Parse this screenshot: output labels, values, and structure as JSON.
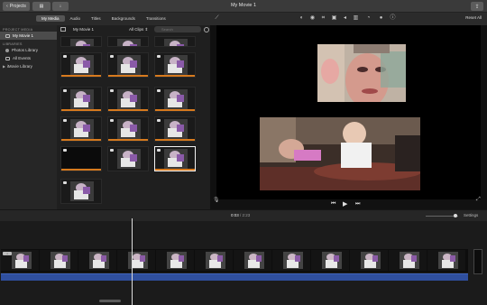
{
  "window": {
    "title": "My Movie 1",
    "projects_label": "Projects"
  },
  "media_tabs": [
    {
      "label": "My Media",
      "active": true
    },
    {
      "label": "Audio",
      "active": false
    },
    {
      "label": "Titles",
      "active": false
    },
    {
      "label": "Backgrounds",
      "active": false
    },
    {
      "label": "Transitions",
      "active": false
    }
  ],
  "sidebar": {
    "project_media_header": "PROJECT MEDIA",
    "project_item": "My Movie 1",
    "libraries_header": "LIBRARIES",
    "library_items": [
      "Photos Library",
      "All Events",
      "iMovie Library"
    ]
  },
  "browser": {
    "title": "My Movie 1",
    "filter": "All Clips",
    "search_placeholder": "Search"
  },
  "viewer": {
    "reset_label": "Reset All",
    "tool_icons": [
      "magic-wand-icon",
      "color-balance-icon",
      "color-correction-icon",
      "crop-icon",
      "stabilization-icon",
      "volume-icon",
      "noise-reduction-icon",
      "speed-icon",
      "filter-icon",
      "info-icon"
    ]
  },
  "timeline": {
    "current_time": "0:03",
    "total_time": "2:23",
    "settings_label": "Settings"
  },
  "colors": {
    "accent_audio": "#2f4f9e",
    "clip_used": "#d77a1e"
  }
}
